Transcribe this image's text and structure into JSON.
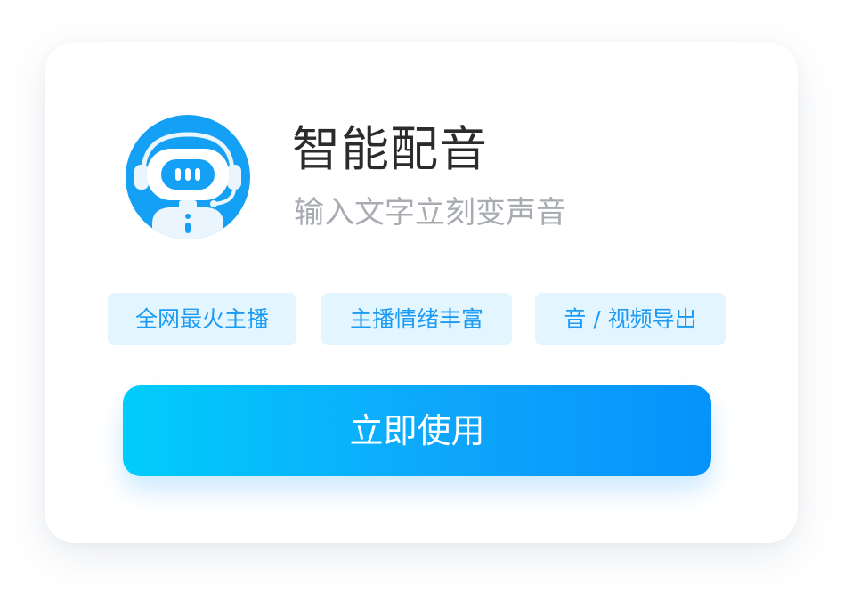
{
  "card": {
    "title": "智能配音",
    "subtitle": "输入文字立刻变声音",
    "avatar_icon": "robot-headset-icon",
    "tags": [
      {
        "label": "全网最火主播"
      },
      {
        "label": "主播情绪丰富"
      },
      {
        "label": "音 / 视频导出"
      }
    ],
    "cta_label": "立即使用"
  },
  "colors": {
    "accent": "#1b9bf4",
    "tag_background": "#e3f5fe",
    "button_gradient_start": "#00cdfb",
    "button_gradient_end": "#0593fb",
    "title": "#2b2b2b",
    "subtitle": "#a8acb2"
  }
}
